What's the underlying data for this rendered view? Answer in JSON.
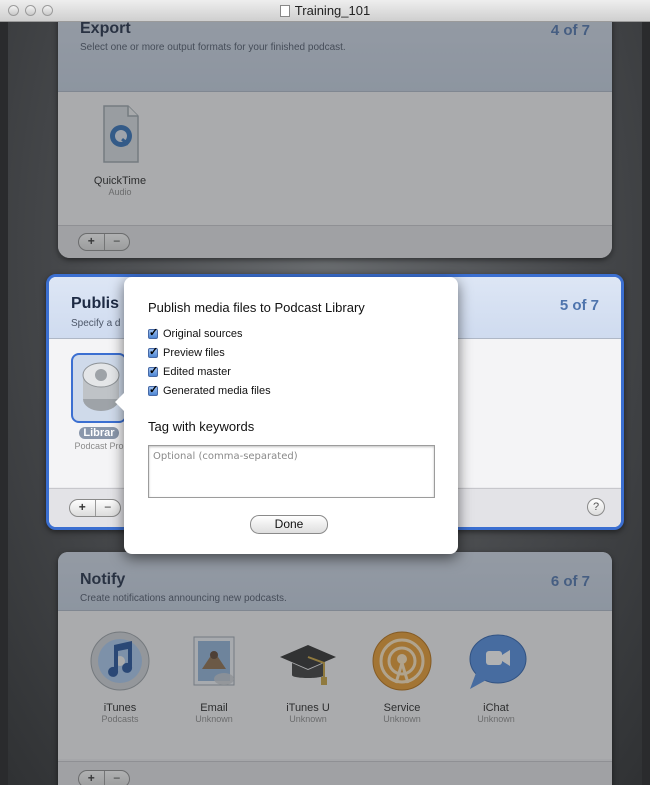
{
  "window": {
    "title": "Training_101"
  },
  "export": {
    "title": "Export",
    "subtitle": "Select one or more output formats for your finished podcast.",
    "step": "4 of 7",
    "items": [
      {
        "label": "QuickTime",
        "sublabel": "Audio",
        "icon": "quicktime-icon"
      }
    ]
  },
  "publish": {
    "title": "Publis",
    "subtitle": "Specify a d",
    "step": "5 of 7",
    "items": [
      {
        "label": "Librar",
        "sublabel": "Podcast Pro",
        "icon": "library-icon"
      }
    ],
    "help": "?"
  },
  "notify": {
    "title": "Notify",
    "subtitle": "Create notifications announcing new podcasts.",
    "step": "6 of 7",
    "items": [
      {
        "label": "iTunes",
        "sublabel": "Podcasts",
        "icon": "itunes-icon"
      },
      {
        "label": "Email",
        "sublabel": "Unknown",
        "icon": "email-icon"
      },
      {
        "label": "iTunes U",
        "sublabel": "Unknown",
        "icon": "itunes-u-icon"
      },
      {
        "label": "Service",
        "sublabel": "Unknown",
        "icon": "service-icon"
      },
      {
        "label": "iChat",
        "sublabel": "Unknown",
        "icon": "ichat-icon"
      }
    ]
  },
  "controls": {
    "plus": "+",
    "minus": "−"
  },
  "sheet": {
    "heading": "Publish media files to Podcast Library",
    "checkboxes": [
      {
        "label": "Original sources",
        "checked": true
      },
      {
        "label": "Preview files",
        "checked": true
      },
      {
        "label": "Edited master",
        "checked": true
      },
      {
        "label": "Generated media files",
        "checked": true
      }
    ],
    "keywords_heading": "Tag with keywords",
    "keywords_placeholder": "Optional (comma-separated)",
    "done_label": "Done"
  },
  "colors": {
    "accent": "#4e74ad",
    "selection": "#3b6fd1",
    "header": "#c7d2e3"
  }
}
